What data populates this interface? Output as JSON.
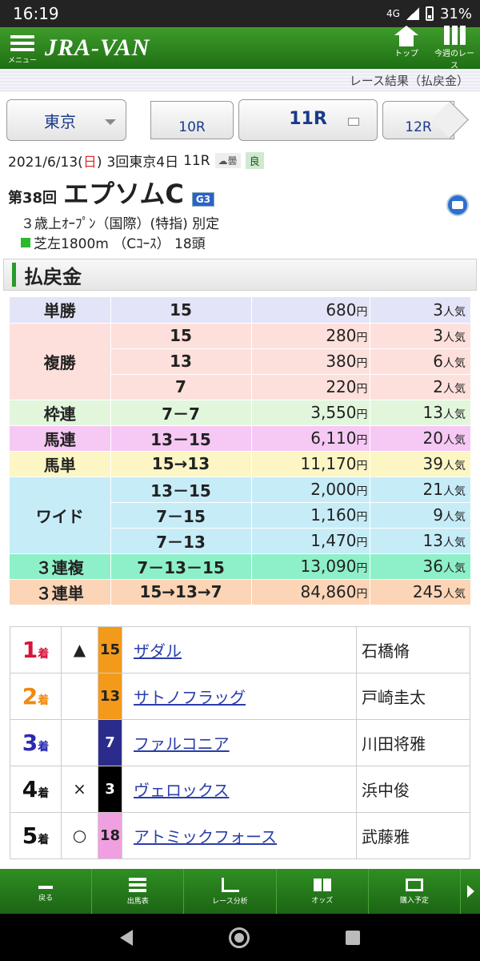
{
  "status_bar": {
    "time": "16:19",
    "network": "4G",
    "battery": "31%"
  },
  "header": {
    "menu_label": "メニュー",
    "logo": "JRA-VAN",
    "top_label": "トップ",
    "week_label": "今週のレース"
  },
  "breadcrumb": "レース結果（払戻金）",
  "race_nav": {
    "venue": "東京",
    "prev": "10R",
    "current": "11R",
    "next": "12R"
  },
  "race_info": {
    "date": "2021/6/13(",
    "weekday": "日",
    "date_end": ")",
    "meeting": "3回東京4日",
    "race_no": "11R",
    "weather": "曇",
    "going": "良",
    "number": "第38回",
    "name": "エプソムC",
    "grade": "G3",
    "conditions": "３歳上ｵｰﾌﾟﾝ（国際）(特指) 別定",
    "course": "芝左1800m （Cｺｰｽ） 18頭"
  },
  "section_title": "払戻金",
  "yen": "円",
  "pop": "人気",
  "payouts": [
    {
      "type": "単勝",
      "cls": "s1",
      "rows": [
        {
          "combo": "15",
          "amount": "680",
          "pop": "3"
        }
      ]
    },
    {
      "type": "複勝",
      "cls": "s2",
      "rows": [
        {
          "combo": "15",
          "amount": "280",
          "pop": "3"
        },
        {
          "combo": "13",
          "amount": "380",
          "pop": "6"
        },
        {
          "combo": "7",
          "amount": "220",
          "pop": "2"
        }
      ]
    },
    {
      "type": "枠連",
      "cls": "s3",
      "rows": [
        {
          "combo": "7－7",
          "amount": "3,550",
          "pop": "13"
        }
      ]
    },
    {
      "type": "馬連",
      "cls": "s4",
      "rows": [
        {
          "combo": "13－15",
          "amount": "6,110",
          "pop": "20"
        }
      ]
    },
    {
      "type": "馬単",
      "cls": "s5",
      "rows": [
        {
          "combo": "15→13",
          "amount": "11,170",
          "pop": "39"
        }
      ]
    },
    {
      "type": "ワイド",
      "cls": "s6",
      "rows": [
        {
          "combo": "13－15",
          "amount": "2,000",
          "pop": "21"
        },
        {
          "combo": "7－15",
          "amount": "1,160",
          "pop": "9"
        },
        {
          "combo": "7－13",
          "amount": "1,470",
          "pop": "13"
        }
      ]
    },
    {
      "type": "３連複",
      "cls": "s7",
      "rows": [
        {
          "combo": "7－13－15",
          "amount": "13,090",
          "pop": "36"
        }
      ]
    },
    {
      "type": "３連単",
      "cls": "s8",
      "rows": [
        {
          "combo": "15→13→7",
          "amount": "84,860",
          "pop": "245"
        }
      ]
    }
  ],
  "results": [
    {
      "pos": "1",
      "suffix": "着",
      "mark": "▲",
      "num": "15",
      "num_bg": "#f39a1a",
      "num_fg": "#222",
      "horse": "ザダル",
      "jockey": "石橋脩"
    },
    {
      "pos": "2",
      "suffix": "着",
      "mark": "",
      "num": "13",
      "num_bg": "#f39a1a",
      "num_fg": "#222",
      "horse": "サトノフラッグ",
      "jockey": "戸崎圭太"
    },
    {
      "pos": "3",
      "suffix": "着",
      "mark": "",
      "num": "7",
      "num_bg": "#2b2b8c",
      "num_fg": "#ffffff",
      "horse": "ファルコニア",
      "jockey": "川田将雅"
    },
    {
      "pos": "4",
      "suffix": "着",
      "mark": "×",
      "num": "3",
      "num_bg": "#000000",
      "num_fg": "#ffffff",
      "horse": "ヴェロックス",
      "jockey": "浜中俊"
    },
    {
      "pos": "5",
      "suffix": "着",
      "mark": "○",
      "num": "18",
      "num_bg": "#f0a0e0",
      "num_fg": "#222",
      "horse": "アトミックフォース",
      "jockey": "武藤雅"
    }
  ],
  "bottom_nav": [
    {
      "label": "戻る",
      "icon": "back-arrow-icon",
      "cls": "back"
    },
    {
      "label": "出馬表",
      "icon": "list-icon",
      "cls": "list"
    },
    {
      "label": "レース分析",
      "icon": "chart-icon",
      "cls": "chart"
    },
    {
      "label": "オッズ",
      "icon": "odds-icon",
      "cls": "odds"
    },
    {
      "label": "購入予定",
      "icon": "ticket-icon",
      "cls": "buy"
    }
  ]
}
